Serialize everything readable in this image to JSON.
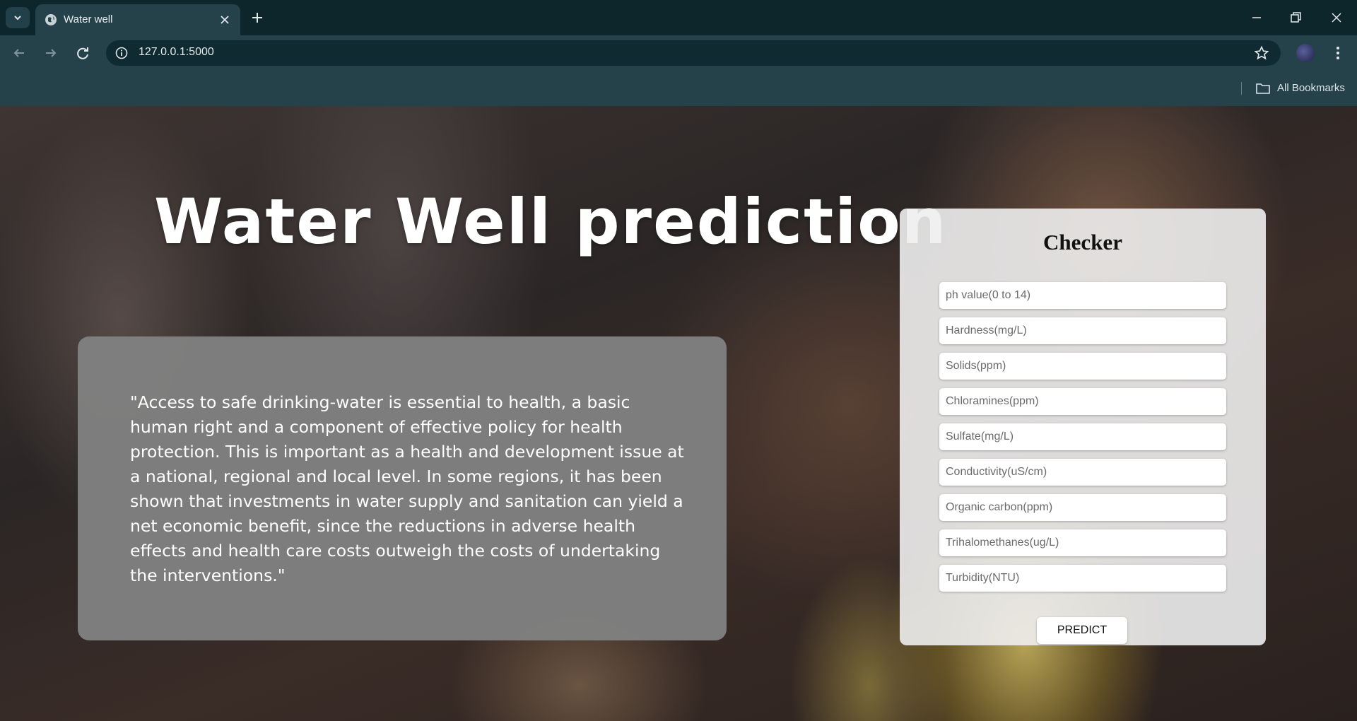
{
  "browser": {
    "tab_title": "Water well",
    "url": "127.0.0.1:5000",
    "bookmarks_label": "All Bookmarks",
    "icons": [
      "tab-search-icon",
      "globe-icon",
      "close-icon",
      "plus-icon",
      "minimize-icon",
      "restore-icon",
      "close-window-icon",
      "back-arrow-icon",
      "forward-arrow-icon",
      "reload-icon",
      "info-icon",
      "star-icon",
      "profile-avatar",
      "more-vert-icon",
      "folder-icon"
    ]
  },
  "hero": {
    "title": "Water Well prediction"
  },
  "quote": {
    "text": "\"Access to safe drinking-water is essential to health, a basic human right and a component of effective policy for health protection. This is important as a health and development issue at a national, regional and local level. In some regions, it has been shown that investments in water supply and sanitation can yield a net economic benefit, since the reductions in adverse health effects and health care costs outweigh the costs of undertaking the interventions.\""
  },
  "checker": {
    "title": "Checker",
    "fields": [
      {
        "placeholder": "ph value(0 to 14)",
        "value": ""
      },
      {
        "placeholder": "Hardness(mg/L)",
        "value": ""
      },
      {
        "placeholder": "Solids(ppm)",
        "value": ""
      },
      {
        "placeholder": "Chloramines(ppm)",
        "value": ""
      },
      {
        "placeholder": "Sulfate(mg/L)",
        "value": ""
      },
      {
        "placeholder": "Conductivity(uS/cm)",
        "value": ""
      },
      {
        "placeholder": "Organic carbon(ppm)",
        "value": ""
      },
      {
        "placeholder": "Trihalomethanes(ug/L)",
        "value": ""
      },
      {
        "placeholder": "Turbidity(NTU)",
        "value": ""
      }
    ],
    "button_label": "PREDICT"
  },
  "colors": {
    "chrome_dark": "#0d262c",
    "chrome": "#25424b",
    "quote_card": "#808080",
    "checker_panel": "#eeeeee"
  }
}
